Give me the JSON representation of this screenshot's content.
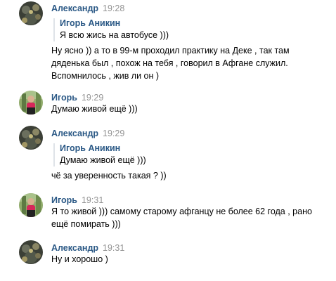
{
  "messages": [
    {
      "author": "Александр",
      "time": "19:28",
      "quote": {
        "author": "Игорь Аникин",
        "text": "Я всю жись на автобусе )))"
      },
      "text": "Ну ясно )) а то в 99-м проходил практику на Деке , так там\nдяденька был , похож на тебя , говорил в Афгане служил.\nВспомнилось , жив ли он )"
    },
    {
      "author": "Игорь",
      "time": "19:29",
      "text": "Думаю живой ещё )))"
    },
    {
      "author": "Александр",
      "time": "19:29",
      "quote": {
        "author": "Игорь Аникин",
        "text": "Думаю живой ещё )))"
      },
      "text": "чё за уверенность такая ? ))"
    },
    {
      "author": "Игорь",
      "time": "19:31",
      "text": "Я то живой ))) самому старому афганцу не более 62 года , рано\nещё помирать )))"
    },
    {
      "author": "Александр",
      "time": "19:31",
      "text": "Ну и хорошо )"
    }
  ]
}
